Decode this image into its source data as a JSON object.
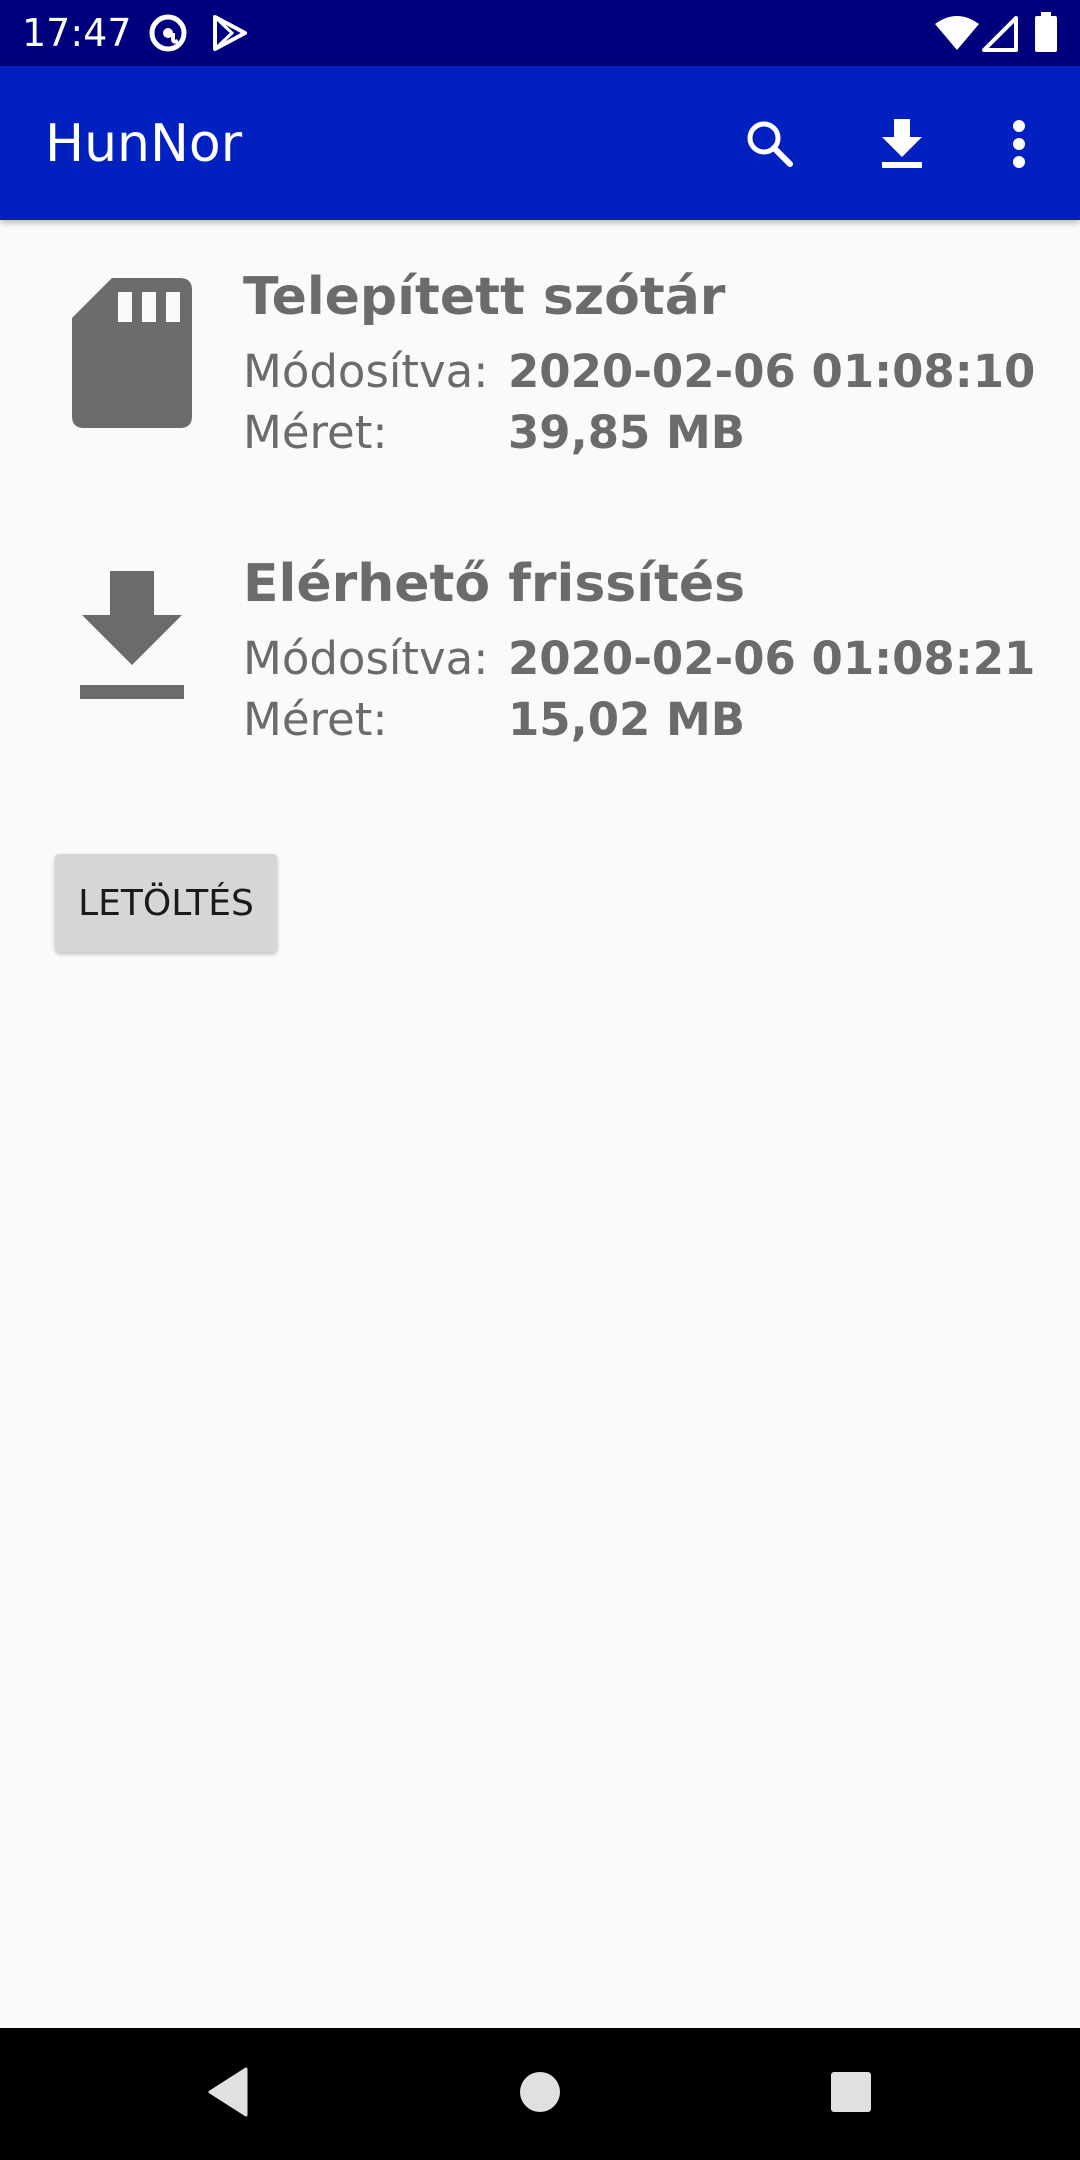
{
  "status_bar": {
    "time": "17:47",
    "left_icons": [
      "at-sign-icon",
      "play-store-icon"
    ],
    "right_icons": [
      "wifi-icon",
      "cell-signal-icon",
      "battery-icon"
    ],
    "background": "#00007e"
  },
  "app_bar": {
    "title": "HunNor",
    "actions": [
      "search-icon",
      "download-icon",
      "more-vert-icon"
    ],
    "background": "#0020c0"
  },
  "items": [
    {
      "icon": "sd-card-icon",
      "title": "Telepített szótár",
      "modified_label": "Módosítva:",
      "modified_value": "2020-02-06 01:08:10",
      "size_label": "Méret:",
      "size_value": "39,85 MB"
    },
    {
      "icon": "download-icon",
      "title": "Elérhető frissítés",
      "modified_label": "Módosítva:",
      "modified_value": "2020-02-06 01:08:21",
      "size_label": "Méret:",
      "size_value": "15,02 MB"
    }
  ],
  "download_button": {
    "label": "LETÖLTÉS"
  },
  "nav_bar": {
    "buttons": [
      "back-icon",
      "home-icon",
      "recents-icon"
    ]
  }
}
